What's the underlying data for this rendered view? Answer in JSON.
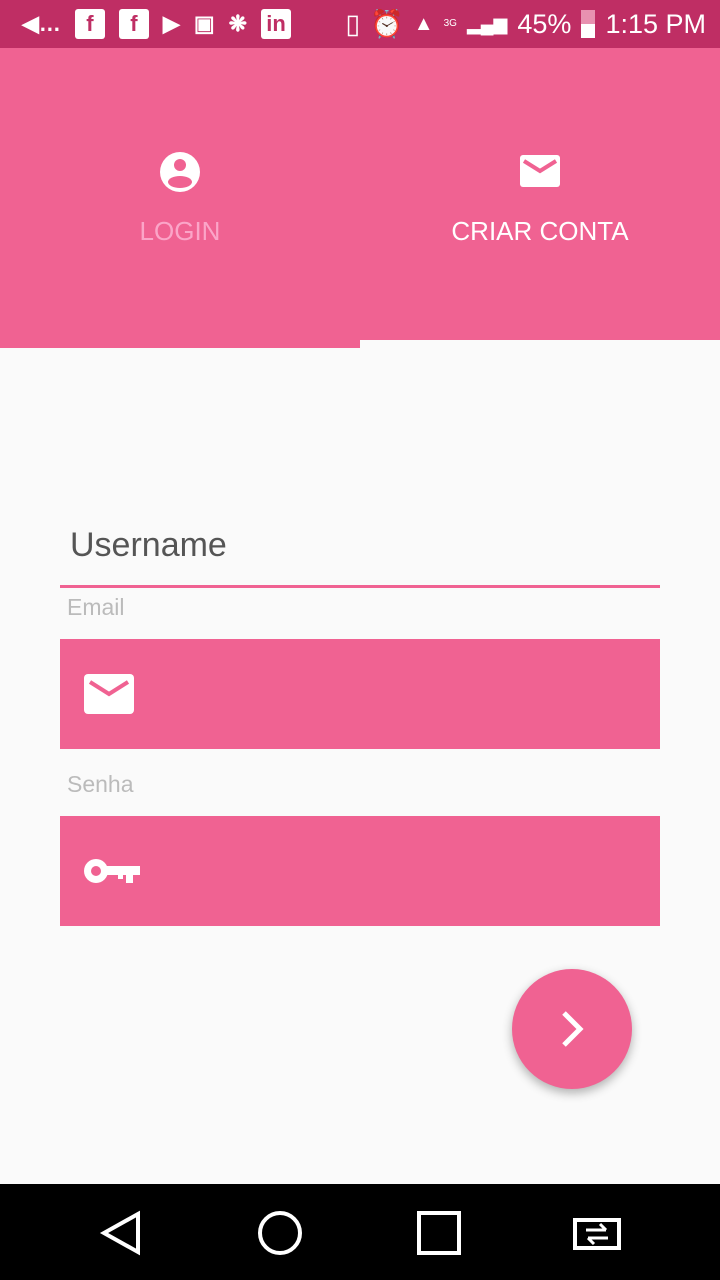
{
  "status_bar": {
    "battery": "45%",
    "time": "1:15 PM",
    "network": "3G",
    "notification_icons": [
      "messages-icon",
      "facebook-icon",
      "facebook-icon",
      "youtube-icon",
      "gallery-icon",
      "asterisk-icon",
      "linkedin-icon"
    ]
  },
  "tabs": [
    {
      "label": "LOGIN",
      "icon": "account-circle-icon",
      "selected": false
    },
    {
      "label": "CRIAR CONTA",
      "icon": "email-icon",
      "selected": true
    }
  ],
  "form": {
    "username_placeholder": "Username",
    "email_label": "Email",
    "email_value": "",
    "password_label": "Senha",
    "password_value": ""
  },
  "colors": {
    "accent": "#f06292",
    "status_bar": "#bf2e64",
    "background": "#fafafa"
  }
}
